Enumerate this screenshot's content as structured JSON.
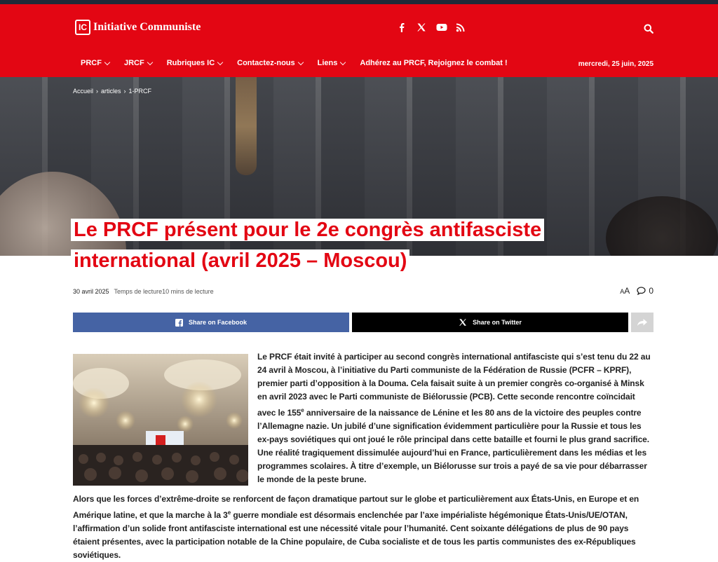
{
  "header": {
    "logo_mark": "IC",
    "logo_text": "Initiative Communiste",
    "date": "mercredi, 25 juin, 2025"
  },
  "nav": {
    "items": [
      {
        "label": "PRCF",
        "dropdown": true
      },
      {
        "label": "JRCF",
        "dropdown": true
      },
      {
        "label": "Rubriques IC",
        "dropdown": true
      },
      {
        "label": "Contactez-nous",
        "dropdown": true
      },
      {
        "label": "Liens",
        "dropdown": true
      },
      {
        "label": "Adhérez au PRCF, Rejoignez le combat !",
        "dropdown": false
      }
    ]
  },
  "breadcrumb": {
    "home": "Accueil",
    "sep": "›",
    "section": "articles",
    "category": "1-PRCF"
  },
  "article": {
    "title": "Le PRCF présent pour le 2e congrès antifasciste international (avril 2025 – Moscou)",
    "date": "30 avril 2025",
    "reading_time": "Temps de lecture10 mins de lecture",
    "comments": "0",
    "font_control": "A",
    "paragraph1_a": "Le PRCF était invité à participer au second congrès international antifasciste qui s’est tenu du 22 au 24 avril à Moscou, à l’initiative du Parti communiste de la Fédération de Russie (PCFR – KPRF), premier parti d’opposition à la Douma. Cela faisait suite à un premier congrès co-organisé à Minsk en avril 2023 avec le Parti communiste de Biélorussie (PCB). Cette seconde rencontre coïncidait avec le 155",
    "paragraph1_sup": "e",
    "paragraph1_b": " anniversaire de la naissance de Lénine et les 80 ans de la victoire des peuples contre l’Allemagne nazie. Un jubilé d’une signification évidemment particulière pour la Russie et tous les ex-pays soviétiques qui ont joué le rôle principal dans cette bataille et fourni le plus grand sacrifice. Une réalité tragiquement dissimulée aujourd’hui en France, particulièrement dans les médias et les programmes scolaires. À titre d’exemple, un Biélorusse sur trois a payé de sa vie pour débarrasser le monde de la peste brune.",
    "paragraph2_a": "Alors que les forces d’extrême-droite se renforcent de façon dramatique partout sur le globe et particulièrement aux États-Unis, en Europe et en Amérique latine, et que la marche à la 3",
    "paragraph2_sup": "e",
    "paragraph2_b": " guerre mondiale est désormais enclenchée par l’axe impérialiste hégémonique États-Unis/UE/OTAN, l’affirmation d’un solide front antifasciste international est une nécessité vitale pour l’humanité. Cent soixante délégations de plus de 90 pays étaient présentes, avec la participation notable de la Chine populaire, de Cuba socialiste et de tous les partis communistes des ex-Républiques soviétiques."
  },
  "share": {
    "facebook": "Share on Facebook",
    "twitter": "Share on Twitter"
  },
  "colors": {
    "brand_red": "#e30613",
    "facebook_blue": "#4563a4",
    "twitter_black": "#000000",
    "more_gray": "#d4d4d4"
  },
  "icons": [
    "facebook-icon",
    "x-icon",
    "youtube-icon",
    "rss-icon",
    "search-icon",
    "chevron-down-icon",
    "comment-icon",
    "share-icon"
  ]
}
